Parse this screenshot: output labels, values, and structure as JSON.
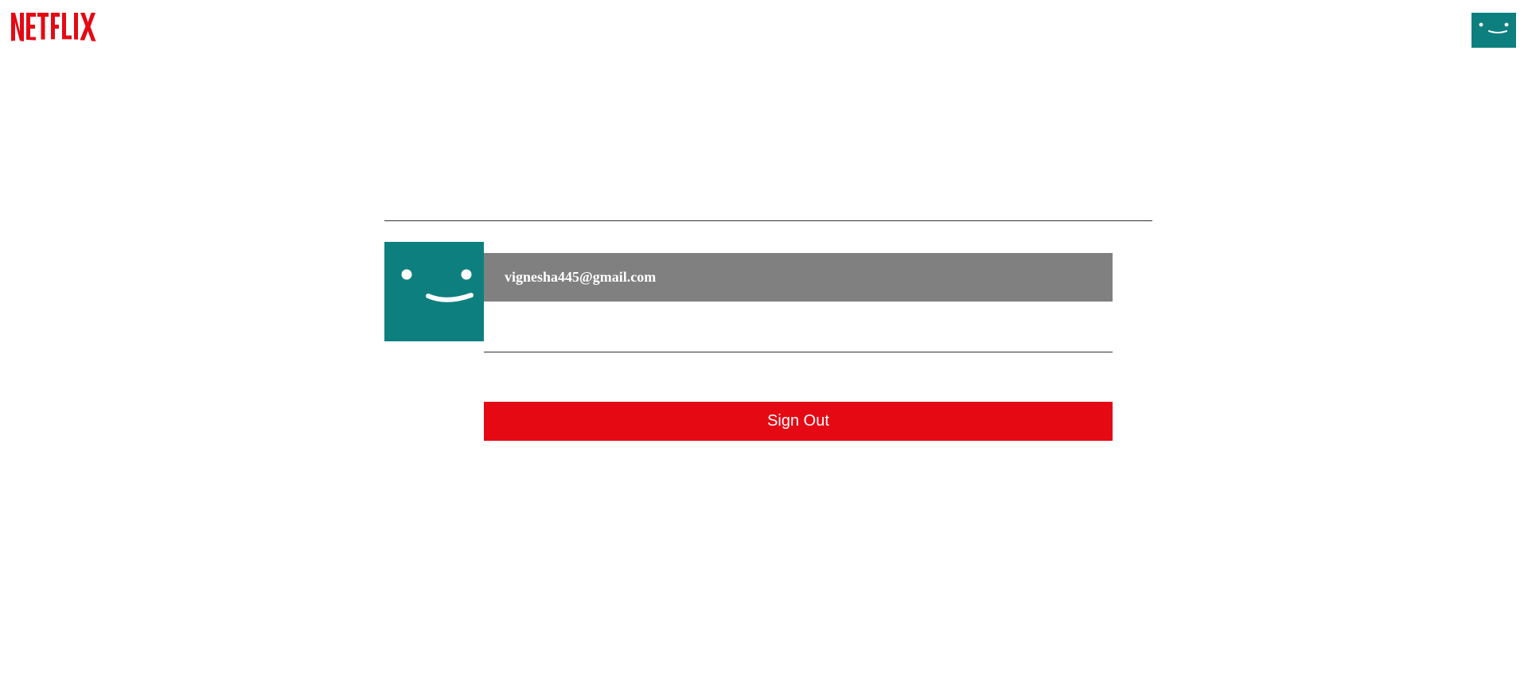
{
  "header": {
    "logo_text": "NETFLIX",
    "logo_color": "#e50914",
    "avatar_icon": "smiley-face-icon",
    "avatar_color": "#0e7f7f"
  },
  "profile": {
    "avatar_icon": "smiley-face-icon",
    "avatar_color": "#0e7f7f",
    "email": "vignesha445@gmail.com",
    "email_bar_color": "#808080"
  },
  "actions": {
    "sign_out_label": "Sign Out",
    "sign_out_color": "#e50914"
  }
}
